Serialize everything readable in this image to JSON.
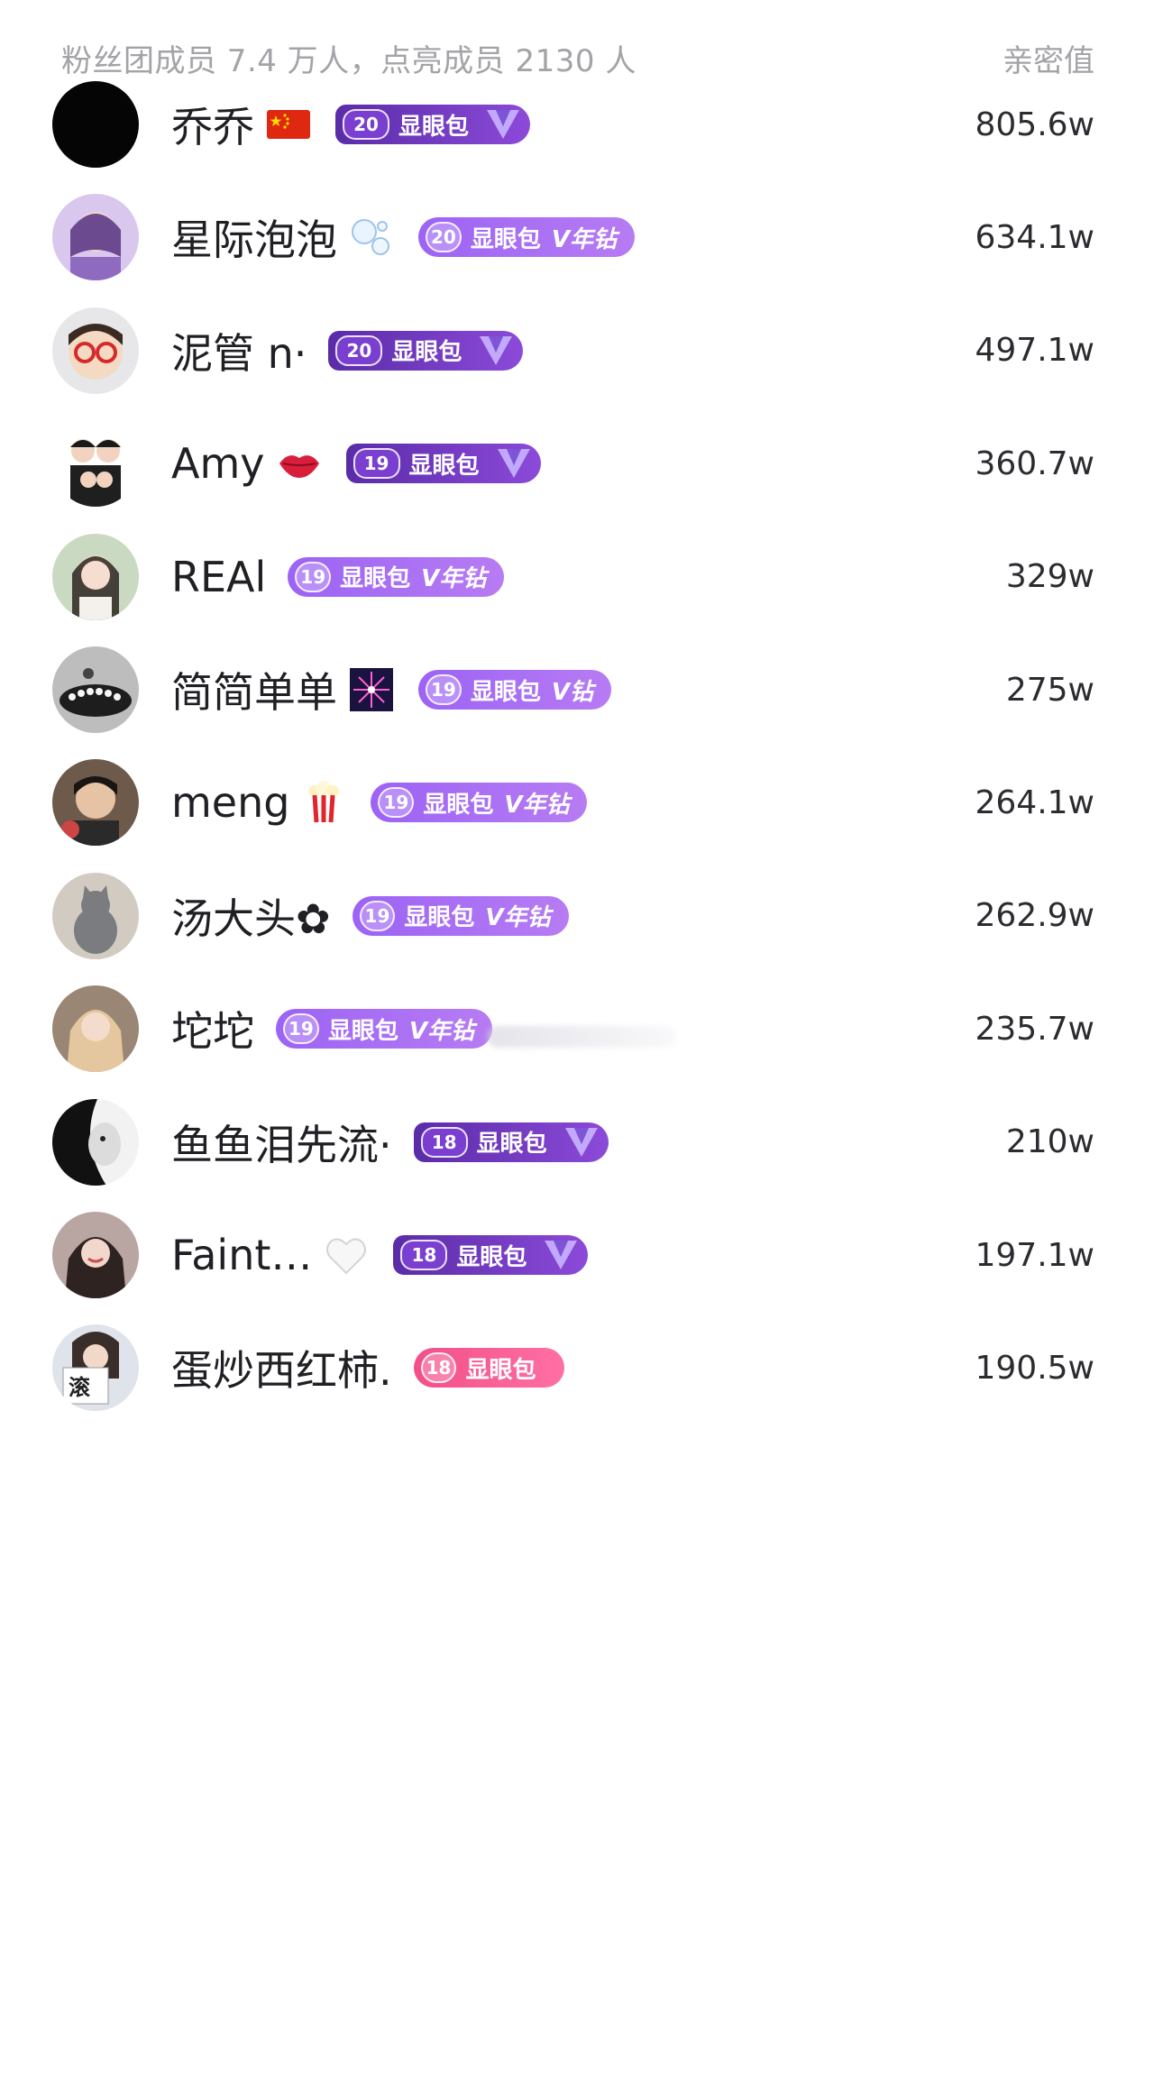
{
  "header": {
    "members_text": "粉丝团成员 7.4 万人，点亮成员 2130 人",
    "score_label": "亲密值"
  },
  "rows": [
    {
      "name": "乔乔",
      "emoji": "china-flag-icon",
      "badge_style": "dark",
      "level": "20",
      "badge_text": "显眼包",
      "badge_tag": "",
      "score": "805.6w",
      "avatar": "black"
    },
    {
      "name": "星际泡泡",
      "emoji": "bubbles-icon",
      "badge_style": "light",
      "level": "20",
      "badge_text": "显眼包",
      "badge_tag": "V年钻",
      "score": "634.1w",
      "avatar": "purple"
    },
    {
      "name": "泥管 n·",
      "emoji": "",
      "badge_style": "dark",
      "level": "20",
      "badge_text": "显眼包",
      "badge_tag": "",
      "score": "497.1w",
      "avatar": "red-glasses"
    },
    {
      "name": "Amy",
      "emoji": "lips-icon",
      "badge_style": "dark",
      "level": "19",
      "badge_text": "显眼包",
      "badge_tag": "",
      "score": "360.7w",
      "avatar": "family"
    },
    {
      "name": "REAl",
      "emoji": "",
      "badge_style": "light",
      "level": "19",
      "badge_text": "显眼包",
      "badge_tag": "V年钻",
      "score": "329w",
      "avatar": "girl"
    },
    {
      "name": "简简单单",
      "emoji": "firework-icon",
      "badge_style": "light",
      "level": "19",
      "badge_text": "显眼包",
      "badge_tag": "V钻",
      "score": "275w",
      "avatar": "pearls"
    },
    {
      "name": "meng",
      "emoji": "popcorn-icon",
      "badge_style": "light",
      "level": "19",
      "badge_text": "显眼包",
      "badge_tag": "V年钻",
      "score": "264.1w",
      "avatar": "boy"
    },
    {
      "name": "汤大头✿",
      "emoji": "",
      "badge_style": "light",
      "level": "19",
      "badge_text": "显眼包",
      "badge_tag": "V年钻",
      "score": "262.9w",
      "avatar": "cat"
    },
    {
      "name": "坨坨",
      "emoji": "",
      "badge_style": "light",
      "level": "19",
      "badge_text": "显眼包",
      "badge_tag": "V年钻",
      "score": "235.7w",
      "avatar": "blonde"
    },
    {
      "name": "鱼鱼泪先流·",
      "emoji": "",
      "badge_style": "dark",
      "level": "18",
      "badge_text": "显眼包",
      "badge_tag": "",
      "score": "210w",
      "avatar": "bw-face"
    },
    {
      "name": "Faint…",
      "emoji": "white-heart-icon",
      "badge_style": "dark",
      "level": "18",
      "badge_text": "显眼包",
      "badge_tag": "",
      "score": "197.1w",
      "avatar": "woman"
    },
    {
      "name": "蛋炒西红柿.",
      "emoji": "",
      "badge_style": "pink",
      "level": "18",
      "badge_text": "显眼包",
      "badge_tag": "",
      "score": "190.5w",
      "avatar": "sign",
      "avatar_text": "滚"
    }
  ],
  "colors": {
    "badge_light": "#9c63f5",
    "badge_dark": "#5a2ca8",
    "badge_pink": "#f24f88",
    "muted_text": "#a3a3a8"
  }
}
